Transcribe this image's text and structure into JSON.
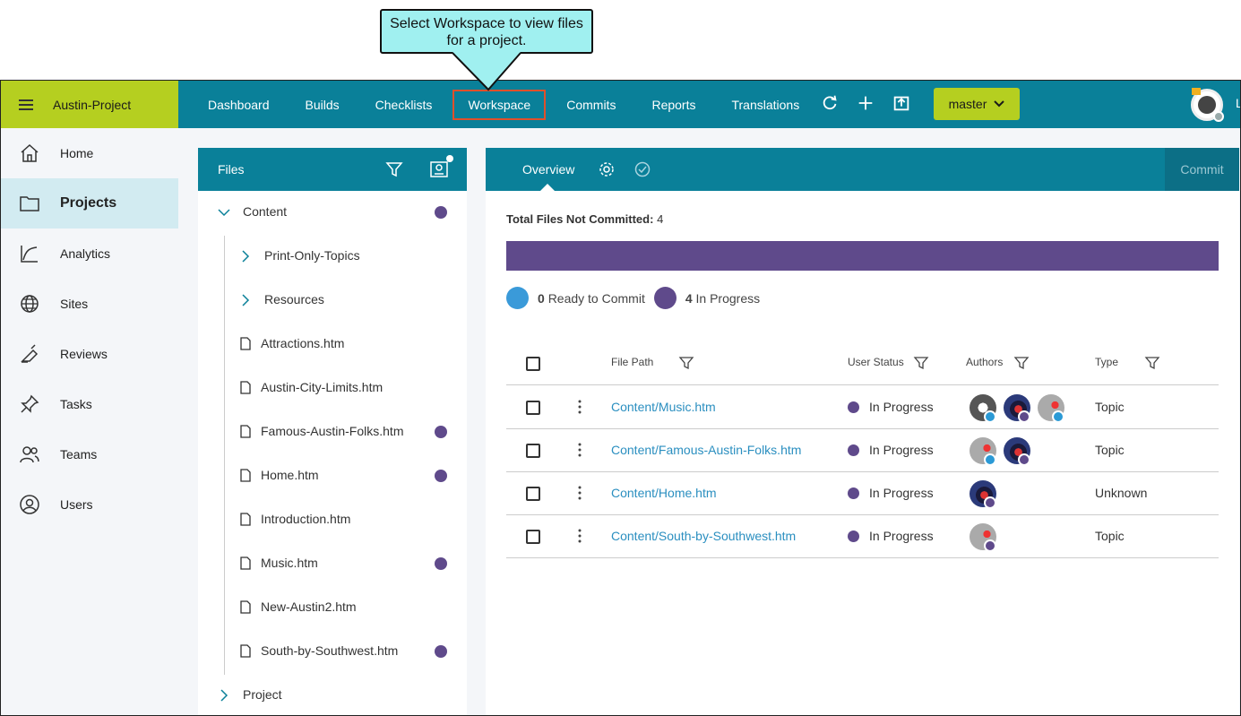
{
  "callout": {
    "text": "Select Workspace to view files for a project."
  },
  "topbar": {
    "project_name": "Austin-Project",
    "nav": [
      "Dashboard",
      "Builds",
      "Checklists",
      "Workspace",
      "Commits",
      "Reports",
      "Translations"
    ],
    "active_nav": "Workspace",
    "branch": "master",
    "user_initial": "L"
  },
  "sidebar": {
    "items": [
      {
        "label": "Home",
        "icon": "home-icon"
      },
      {
        "label": "Projects",
        "icon": "folder-icon",
        "active": true
      },
      {
        "label": "Analytics",
        "icon": "analytics-icon"
      },
      {
        "label": "Sites",
        "icon": "globe-icon"
      },
      {
        "label": "Reviews",
        "icon": "review-pen-icon"
      },
      {
        "label": "Tasks",
        "icon": "pin-icon"
      },
      {
        "label": "Teams",
        "icon": "team-icon"
      },
      {
        "label": "Users",
        "icon": "user-icon"
      }
    ]
  },
  "files_panel": {
    "title": "Files",
    "tree": [
      {
        "label": "Content",
        "type": "folder-open",
        "in_progress": true
      },
      {
        "label": "Print-Only-Topics",
        "type": "folder",
        "in_progress": false
      },
      {
        "label": "Resources",
        "type": "folder",
        "in_progress": false
      },
      {
        "label": "Attractions.htm",
        "type": "file",
        "in_progress": false
      },
      {
        "label": "Austin-City-Limits.htm",
        "type": "file",
        "in_progress": false
      },
      {
        "label": "Famous-Austin-Folks.htm",
        "type": "file",
        "in_progress": true
      },
      {
        "label": "Home.htm",
        "type": "file",
        "in_progress": true
      },
      {
        "label": "Introduction.htm",
        "type": "file",
        "in_progress": false
      },
      {
        "label": "Music.htm",
        "type": "file",
        "in_progress": true
      },
      {
        "label": "New-Austin2.htm",
        "type": "file",
        "in_progress": false
      },
      {
        "label": "South-by-Southwest.htm",
        "type": "file",
        "in_progress": true
      },
      {
        "label": "Project",
        "type": "folder",
        "in_progress": false
      }
    ]
  },
  "main": {
    "tab": "Overview",
    "commit_label": "Commit",
    "total_label": "Total Files Not Committed:",
    "total_value": "4",
    "legend": [
      {
        "count": "0",
        "label": "Ready to Commit",
        "color": "#3a9ad9"
      },
      {
        "count": "4",
        "label": "In Progress",
        "color": "#5f4a8b"
      }
    ],
    "columns": [
      "File Path",
      "User Status",
      "Authors",
      "Type"
    ],
    "rows": [
      {
        "path": "Content/Music.htm",
        "status": "In Progress",
        "type": "Topic"
      },
      {
        "path": "Content/Famous-Austin-Folks.htm",
        "status": "In Progress",
        "type": "Topic"
      },
      {
        "path": "Content/Home.htm",
        "status": "In Progress",
        "type": "Unknown"
      },
      {
        "path": "Content/South-by-Southwest.htm",
        "status": "In Progress",
        "type": "Topic"
      }
    ]
  },
  "colors": {
    "teal": "#0a8099",
    "lime": "#b5cf20",
    "purple": "#5f4a8b",
    "blue": "#3a9ad9",
    "highlight": "#e0502b"
  }
}
